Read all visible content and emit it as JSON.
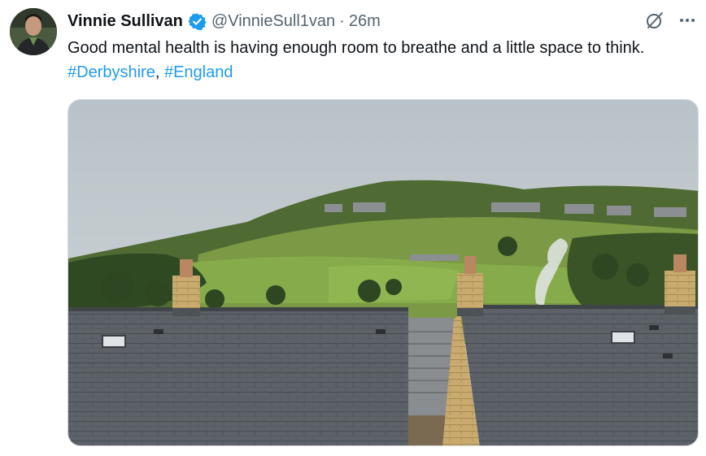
{
  "tweet": {
    "author_name": "Vinnie Sullivan",
    "handle": "@VinnieSull1van",
    "separator": "·",
    "time": "26m",
    "text_before": "Good mental health is having enough room to breathe and a little space to think. ",
    "hashtag1": "#Derbyshire",
    "comma": ", ",
    "hashtag2": "#England"
  },
  "icons": {
    "verified": "verified-badge-icon",
    "grok": "grok-icon",
    "more": "more-options-icon"
  },
  "colors": {
    "accent": "#1d9bf0",
    "text_primary": "#0f1419",
    "text_secondary": "#536471"
  }
}
